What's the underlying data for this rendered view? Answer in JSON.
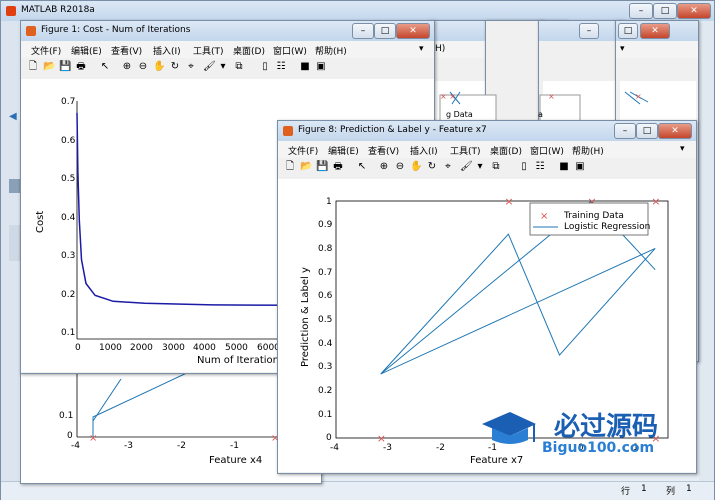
{
  "desktop": {
    "app_title": "MATLAB R2018a",
    "status_row_label": "行",
    "status_row_value": "1",
    "status_col_label": "列",
    "status_col_value": "1"
  },
  "figure_menu": [
    "文件(F)",
    "编辑(E)",
    "查看(V)",
    "插入(I)",
    "工具(T)",
    "桌面(D)",
    "窗口(W)",
    "帮助(H)"
  ],
  "figure1": {
    "title": "Figure 1: Cost - Num of Iterations",
    "ylabel": "Cost",
    "xlabel": "Num of Iterations",
    "yticks": [
      "0.7",
      "0.6",
      "0.5",
      "0.4",
      "0.3",
      "0.2",
      "0.1"
    ],
    "xticks": [
      "0",
      "1000",
      "2000",
      "3000",
      "4000",
      "5000",
      "6000"
    ]
  },
  "figure4": {
    "xlabel": "Feature x4",
    "yticks": [
      "0.1",
      "0"
    ],
    "xticks": [
      "-4",
      "-3",
      "-2",
      "-1",
      "0"
    ]
  },
  "figure8": {
    "title": "Figure 8: Prediction & Label y - Feature x7",
    "ylabel": "Prediction & Label y",
    "xlabel": "Feature x7",
    "legend_training": "Training Data",
    "legend_regression": "Logistic Regression",
    "yticks": [
      "1",
      "0.9",
      "0.8",
      "0.7",
      "0.6",
      "0.5",
      "0.4",
      "0.3",
      "0.2",
      "0.1",
      "0"
    ],
    "xticks": [
      "-4",
      "-3",
      "-2",
      "-1",
      "0",
      "1"
    ]
  },
  "background_legend_text": [
    "g Data",
    "a"
  ],
  "watermark": {
    "text_cn": "必过源码",
    "text_url": "Biguo100.com"
  },
  "colors": {
    "line": "#1f77b4",
    "marker": "#d9534f",
    "cost_line": "#1a1aa6"
  },
  "chart_data": [
    {
      "type": "line",
      "title": "Figure 1: Cost - Num of Iterations",
      "xlabel": "Num of Iterations",
      "ylabel": "Cost",
      "xlim": [
        0,
        7000
      ],
      "ylim": [
        0.1,
        0.7
      ],
      "series": [
        {
          "x": [
            0,
            20,
            50,
            100,
            200,
            400,
            800,
            1500,
            3000,
            5000,
            6500
          ],
          "y": [
            0.67,
            0.52,
            0.4,
            0.3,
            0.24,
            0.21,
            0.195,
            0.19,
            0.186,
            0.185,
            0.185
          ]
        }
      ]
    },
    {
      "type": "line",
      "title": "Figure 8: Prediction & Label y - Feature x7",
      "xlabel": "Feature x7",
      "ylabel": "Prediction & Label y",
      "xlim": [
        -4,
        1.2
      ],
      "ylim": [
        0,
        1
      ],
      "series": [
        {
          "name": "Training Data",
          "x": [
            -3.3,
            -1.3,
            0,
            1,
            1
          ],
          "y": [
            0,
            1,
            1,
            1,
            0
          ]
        },
        {
          "name": "Logistic Regression",
          "x": [
            -3.3,
            -1.3,
            -0.5,
            1,
            -3.3,
            0,
            1,
            0
          ],
          "y": [
            0.27,
            0.86,
            0.35,
            0.8,
            0.27,
            1,
            0.71,
            1
          ]
        }
      ]
    }
  ]
}
